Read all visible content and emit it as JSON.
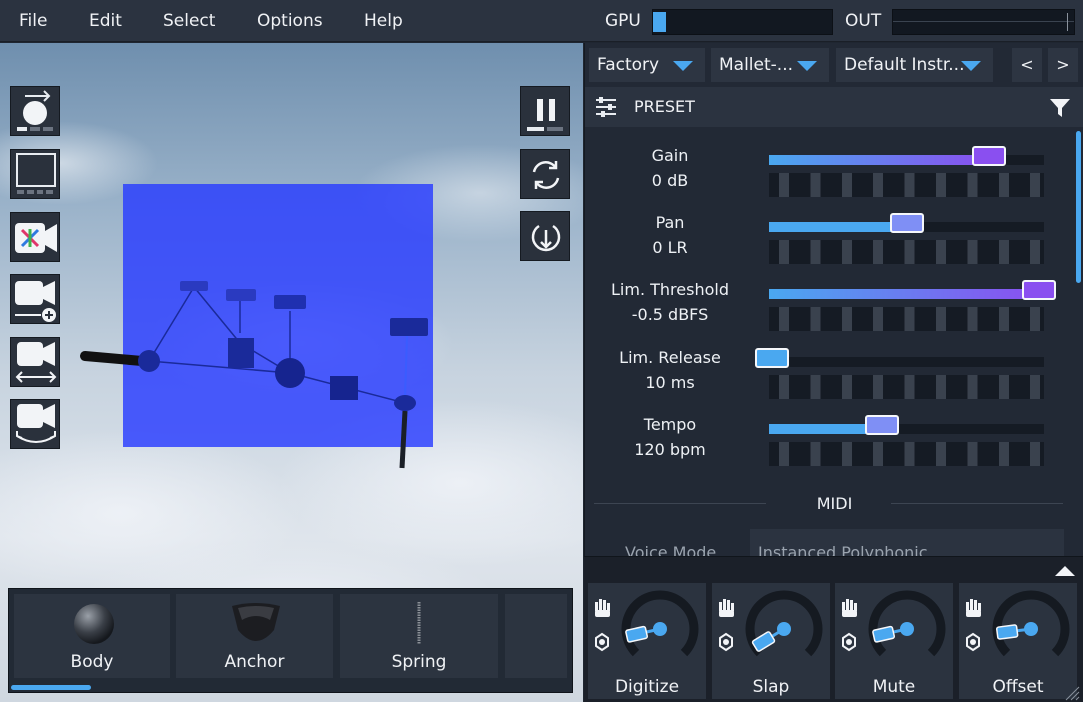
{
  "menu": [
    "File",
    "Edit",
    "Select",
    "Options",
    "Help"
  ],
  "meters": {
    "gpu_label": "GPU",
    "gpu_level": 0.07,
    "out_label": "OUT",
    "out_level": 0.0
  },
  "viewport": {
    "tools_left": [
      "apply-force-tool",
      "select-box-tool",
      "camera-reset-tool",
      "camera-add-tool",
      "camera-pan-tool",
      "camera-orbit-tool"
    ],
    "tools_right": [
      "pause",
      "reset",
      "download"
    ]
  },
  "palette": {
    "items": [
      {
        "label": "Body",
        "icon": "sphere-icon"
      },
      {
        "label": "Anchor",
        "icon": "anchor-icon"
      },
      {
        "label": "Spring",
        "icon": "spring-icon"
      }
    ]
  },
  "panel": {
    "dropdowns": [
      "Factory",
      "Mallet-...",
      "Default Instr..."
    ],
    "prev": "<",
    "next": ">",
    "preset_title": "PRESET",
    "params": [
      {
        "name": "Gain",
        "value": "0 dB",
        "level": 0.8
      },
      {
        "name": "Pan",
        "value": "0 LR",
        "level": 0.5
      },
      {
        "name": "Lim. Threshold",
        "value": "-0.5 dBFS",
        "level": 0.98
      },
      {
        "name": "Lim. Release",
        "value": "10 ms",
        "level": 0.01
      },
      {
        "name": "Tempo",
        "value": "120 bpm",
        "level": 0.41
      }
    ],
    "midi_title": "MIDI",
    "voice_mode_label": "Voice Mode",
    "voice_mode_value": "Instanced Polyphonic"
  },
  "macros": [
    {
      "label": "Digitize",
      "level": 0.12
    },
    {
      "label": "Slap",
      "level": 0.05
    },
    {
      "label": "Mute",
      "level": 0.12
    },
    {
      "label": "Offset",
      "level": 0.14
    }
  ],
  "colors": {
    "accent": "#4aa8f0",
    "purple": "#8a4ff0",
    "overlay": "#2838ff"
  }
}
